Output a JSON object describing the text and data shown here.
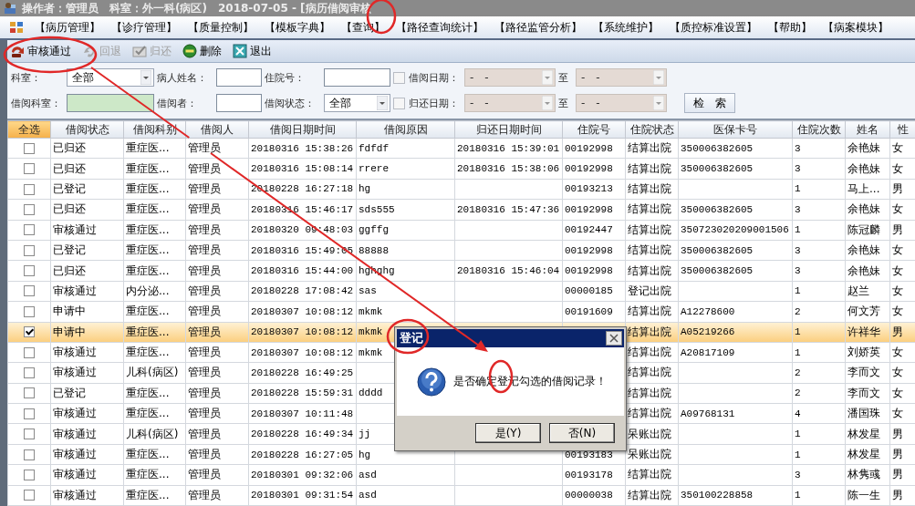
{
  "window": {
    "title": "操作者：管理员　科室：外一科(病区)　2018-07-05 - [病历借阅审核"
  },
  "menu": [
    "【病历管理】",
    "【诊疗管理】",
    "【质量控制】",
    "【模板字典】",
    "【查询】",
    "【路径查询统计】",
    "【路径监管分析】",
    "【系统维护】",
    "【质控标准设置】",
    "【帮助】",
    "【病案模块】"
  ],
  "toolbar": [
    {
      "label": "审核通过",
      "kind": "approve",
      "disabled": false
    },
    {
      "label": "回退",
      "kind": "undo",
      "disabled": true
    },
    {
      "label": "归还",
      "kind": "return",
      "disabled": true
    },
    {
      "label": "删除",
      "kind": "delete",
      "disabled": false
    },
    {
      "label": "退出",
      "kind": "exit",
      "disabled": false
    }
  ],
  "filters": {
    "rows": [
      [
        {
          "kind": "label",
          "text": "科室："
        },
        {
          "kind": "combo",
          "value": "全部"
        },
        {
          "kind": "label",
          "text": "病人姓名："
        },
        {
          "kind": "field"
        },
        {
          "kind": "label",
          "text": "住院号："
        },
        {
          "kind": "field"
        },
        {
          "kind": "checkbox",
          "checked": false
        },
        {
          "kind": "label",
          "text": "借阅日期："
        },
        {
          "kind": "date",
          "value": "-　-",
          "disabled": true
        },
        {
          "kind": "label",
          "text": "至"
        },
        {
          "kind": "date",
          "value": "-　-",
          "disabled": true
        }
      ],
      [
        {
          "kind": "label",
          "text": "借阅科室："
        },
        {
          "kind": "field",
          "color": "#cde8c8"
        },
        {
          "kind": "label",
          "text": "借阅者："
        },
        {
          "kind": "field"
        },
        {
          "kind": "label",
          "text": "借阅状态："
        },
        {
          "kind": "combo",
          "value": "全部"
        },
        {
          "kind": "checkbox",
          "checked": false
        },
        {
          "kind": "label",
          "text": "归还日期："
        },
        {
          "kind": "date",
          "value": "-　-",
          "disabled": true
        },
        {
          "kind": "label",
          "text": "至"
        },
        {
          "kind": "date",
          "value": "-　-",
          "disabled": true
        },
        {
          "kind": "button",
          "text": "检　索"
        }
      ]
    ]
  },
  "table": {
    "columns": [
      "全选",
      "借阅状态",
      "借阅科别",
      "借阅人",
      "借阅日期时间",
      "借阅原因",
      "归还日期时间",
      "住院号",
      "住院状态",
      "医保卡号",
      "住院次数",
      "姓名",
      "性"
    ],
    "rows": [
      {
        "checked": false,
        "selected": false,
        "status": "已归还",
        "department": "重症医...",
        "borrower": "管理员",
        "borrow_time": "20180316 15:38:26",
        "reason": "fdfdf",
        "return_time": "20180316 15:39:01",
        "inpatient_no": "00192998",
        "inpatient_status": "结算出院",
        "insurance_card": "350006382605",
        "admissions": "3",
        "name": "余艳妹",
        "sex": "女"
      },
      {
        "checked": false,
        "selected": false,
        "status": "已归还",
        "department": "重症医...",
        "borrower": "管理员",
        "borrow_time": "20180316 15:08:14",
        "reason": "rrere",
        "return_time": "20180316 15:38:06",
        "inpatient_no": "00192998",
        "inpatient_status": "结算出院",
        "insurance_card": "350006382605",
        "admissions": "3",
        "name": "余艳妹",
        "sex": "女"
      },
      {
        "checked": false,
        "selected": false,
        "status": "已登记",
        "department": "重症医...",
        "borrower": "管理员",
        "borrow_time": "20180228 16:27:18",
        "reason": "hg",
        "inpatient_no": "00193213",
        "inpatient_status": "结算出院",
        "admissions": "1",
        "name": "马上...",
        "sex": "男"
      },
      {
        "checked": false,
        "selected": false,
        "status": "已归还",
        "department": "重症医...",
        "borrower": "管理员",
        "borrow_time": "20180316 15:46:17",
        "reason": "sds555",
        "return_time": "20180316 15:47:36",
        "inpatient_no": "00192998",
        "inpatient_status": "结算出院",
        "insurance_card": "350006382605",
        "admissions": "3",
        "name": "余艳妹",
        "sex": "女"
      },
      {
        "checked": false,
        "selected": false,
        "status": "审核通过",
        "department": "重症医...",
        "borrower": "管理员",
        "borrow_time": "20180320 09:48:03",
        "reason": "ggffg",
        "inpatient_no": "00192447",
        "inpatient_status": "结算出院",
        "insurance_card": "350723020209001506",
        "admissions": "1",
        "name": "陈冠麟",
        "sex": "男"
      },
      {
        "checked": false,
        "selected": false,
        "status": "已登记",
        "department": "重症医...",
        "borrower": "管理员",
        "borrow_time": "20180316 15:49:05",
        "reason": "88888",
        "inpatient_no": "00192998",
        "inpatient_status": "结算出院",
        "insurance_card": "350006382605",
        "admissions": "3",
        "name": "余艳妹",
        "sex": "女"
      },
      {
        "checked": false,
        "selected": false,
        "status": "已归还",
        "department": "重症医...",
        "borrower": "管理员",
        "borrow_time": "20180316 15:44:00",
        "reason": "hghghg",
        "return_time": "20180316 15:46:04",
        "inpatient_no": "00192998",
        "inpatient_status": "结算出院",
        "insurance_card": "350006382605",
        "admissions": "3",
        "name": "余艳妹",
        "sex": "女"
      },
      {
        "checked": false,
        "selected": false,
        "status": "审核通过",
        "department": "内分泌...",
        "borrower": "管理员",
        "borrow_time": "20180228 17:08:42",
        "reason": "sas",
        "inpatient_no": "00000185",
        "inpatient_status": "登记出院",
        "admissions": "1",
        "name": "赵兰",
        "sex": "女"
      },
      {
        "checked": false,
        "selected": false,
        "status": "申请中",
        "department": "重症医...",
        "borrower": "管理员",
        "borrow_time": "20180307 10:08:12",
        "reason": "mkmk",
        "inpatient_no": "00191609",
        "inpatient_status": "结算出院",
        "insurance_card": "A12278600",
        "admissions": "2",
        "name": "何文芳",
        "sex": "女"
      },
      {
        "checked": true,
        "selected": true,
        "status": "申请中",
        "department": "重症医...",
        "borrower": "管理员",
        "borrow_time": "20180307 10:08:12",
        "reason": "mkmk",
        "inpatient_status": "结算出院",
        "insurance_card": "A05219266",
        "admissions": "1",
        "name": "许祥华",
        "sex": "男"
      },
      {
        "checked": false,
        "selected": false,
        "status": "审核通过",
        "department": "重症医...",
        "borrower": "管理员",
        "borrow_time": "20180307 10:08:12",
        "reason": "mkmk",
        "inpatient_status": "结算出院",
        "insurance_card": "A20817109",
        "admissions": "1",
        "name": "刘娇英",
        "sex": "女"
      },
      {
        "checked": false,
        "selected": false,
        "status": "审核通过",
        "department": "儿科(病区)",
        "borrower": "管理员",
        "borrow_time": "20180228 16:49:25",
        "inpatient_status": "结算出院",
        "admissions": "2",
        "name": "李而文",
        "sex": "女"
      },
      {
        "checked": false,
        "selected": false,
        "status": "已登记",
        "department": "重症医...",
        "borrower": "管理员",
        "borrow_time": "20180228 15:59:31",
        "reason": "dddd",
        "inpatient_status": "结算出院",
        "admissions": "2",
        "name": "李而文",
        "sex": "女"
      },
      {
        "checked": false,
        "selected": false,
        "status": "审核通过",
        "department": "重症医...",
        "borrower": "管理员",
        "borrow_time": "20180307 10:11:48",
        "inpatient_status": "结算出院",
        "insurance_card": "A09768131",
        "admissions": "4",
        "name": "潘国珠",
        "sex": "女"
      },
      {
        "checked": false,
        "selected": false,
        "status": "审核通过",
        "department": "儿科(病区)",
        "borrower": "管理员",
        "borrow_time": "20180228 16:49:34",
        "reason": "jj",
        "inpatient_status": "呆账出院",
        "admissions": "1",
        "name": "林发星",
        "sex": "男"
      },
      {
        "checked": false,
        "selected": false,
        "status": "审核通过",
        "department": "重症医...",
        "borrower": "管理员",
        "borrow_time": "20180228 16:27:05",
        "reason": "hg",
        "inpatient_no": "00193183",
        "inpatient_status": "呆账出院",
        "admissions": "1",
        "name": "林发星",
        "sex": "男"
      },
      {
        "checked": false,
        "selected": false,
        "status": "审核通过",
        "department": "重症医...",
        "borrower": "管理员",
        "borrow_time": "20180301 09:32:06",
        "reason": "asd",
        "inpatient_no": "00193178",
        "inpatient_status": "结算出院",
        "admissions": "3",
        "name": "林隽彧",
        "sex": "男"
      },
      {
        "checked": false,
        "selected": false,
        "status": "审核通过",
        "department": "重症医...",
        "borrower": "管理员",
        "borrow_time": "20180301 09:31:54",
        "reason": "asd",
        "inpatient_no": "00000038",
        "inpatient_status": "结算出院",
        "insurance_card": "350100228858",
        "admissions": "1",
        "name": "陈一生",
        "sex": "男"
      }
    ]
  },
  "dialog": {
    "title": "登记",
    "message": "是否确定登记勾选的借阅记录！",
    "buttons": [
      "是(Y)",
      "否(N)"
    ]
  }
}
